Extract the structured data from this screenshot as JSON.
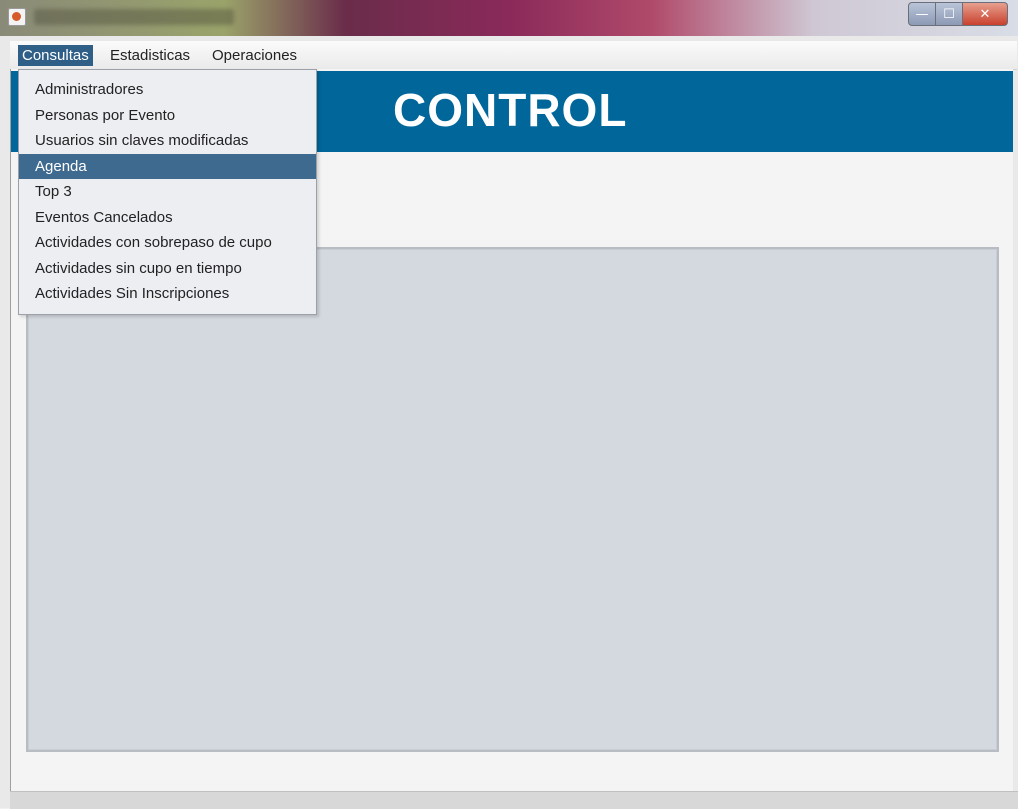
{
  "menubar": {
    "menus": [
      {
        "label": "Consultas",
        "active": true
      },
      {
        "label": "Estadisticas",
        "active": false
      },
      {
        "label": "Operaciones",
        "active": false
      }
    ]
  },
  "dropdown": {
    "items": [
      {
        "label": "Administradores"
      },
      {
        "label": "Personas por Evento"
      },
      {
        "label": "Usuarios sin claves modificadas"
      },
      {
        "label": "Agenda",
        "selected": true
      },
      {
        "label": "Top 3"
      },
      {
        "label": "Eventos Cancelados"
      },
      {
        "label": "Actividades con sobrepaso de cupo"
      },
      {
        "label": "Actividades sin cupo en tiempo"
      },
      {
        "label": "Actividades Sin Inscripciones"
      }
    ]
  },
  "header": {
    "title": "CONTROL"
  },
  "window_controls": {
    "minimize": "—",
    "maximize": "☐",
    "close": "✕"
  },
  "colors": {
    "header_band": "#01669a",
    "menu_active": "#2f5f87",
    "item_selected": "#3f6a90",
    "panel": "#d4d8df"
  }
}
